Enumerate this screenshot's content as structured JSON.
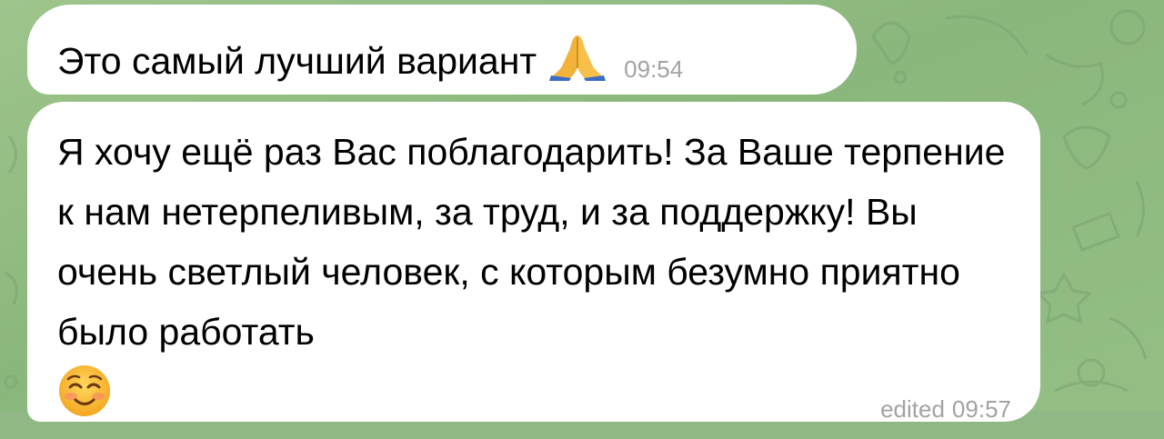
{
  "chat": {
    "messages": [
      {
        "text": "Это самый лучший вариант",
        "emoji": "folded-hands-emoji",
        "time": "09:54"
      },
      {
        "text": "Я хочу ещё раз Вас поблагодарить! За Ваше терпение к нам нетерпеливым, за труд, и за поддержку! Вы очень светлый человек, с которым безумно приятно было работать",
        "emoji": "smiling-face-emoji",
        "edited_label": "edited",
        "time": "09:57"
      }
    ]
  },
  "colors": {
    "wallpaper": "#8fb884",
    "bubble": "#ffffff",
    "timestamp": "#a3a3a3"
  }
}
